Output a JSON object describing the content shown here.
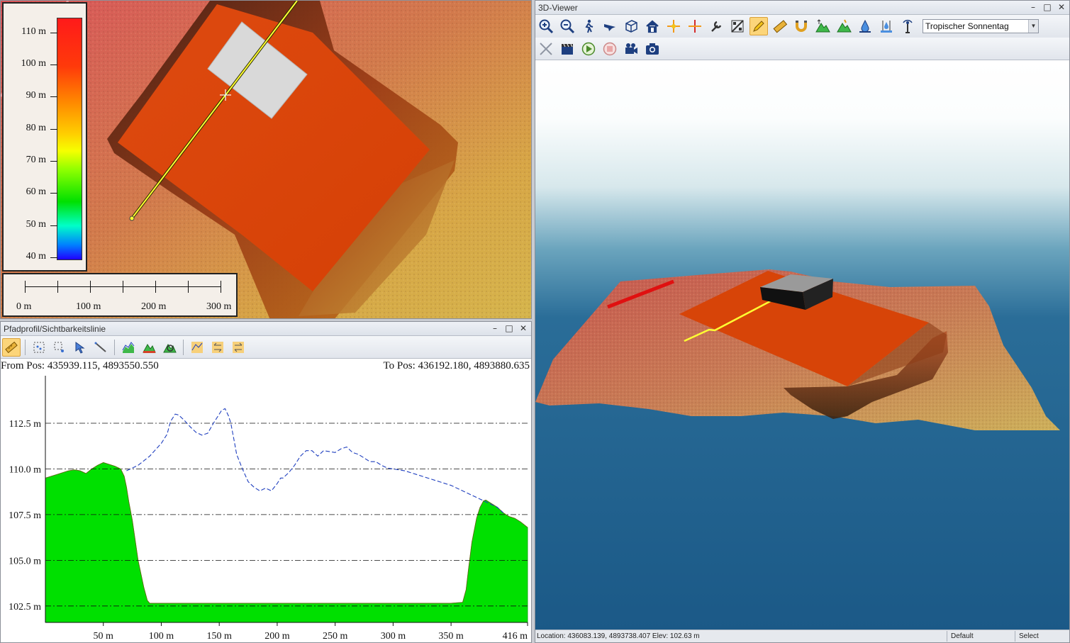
{
  "map": {
    "legend": {
      "ticks": [
        "110 m",
        "100 m",
        "90 m",
        "80 m",
        "70 m",
        "60 m",
        "50 m",
        "40 m"
      ]
    },
    "scalebar": {
      "labels": [
        "0 m",
        "100 m",
        "200 m",
        "300 m"
      ]
    }
  },
  "profile": {
    "title": "Pfadprofil/Sichtbarkeitslinie",
    "from_label": "From Pos: 435939.115, 4893550.550",
    "to_label": "To Pos: 436192.180, 4893880.635",
    "toolbar_icons": [
      "measure-path-icon",
      "select-points-icon",
      "select-area-icon",
      "pointer-icon",
      "line-tool-icon",
      "profile-chart-icon",
      "terrain-icon",
      "terrain-zoom-icon",
      "line-of-sight-icon",
      "reverse-icon",
      "swap-icon"
    ],
    "colors": {
      "terrain_fill": "#00e000",
      "sight_line": "#1f3fbf",
      "grid": "#111111"
    }
  },
  "chart_data": {
    "type": "area",
    "title": "",
    "xlabel": "",
    "ylabel": "",
    "xlim": [
      0,
      416
    ],
    "ylim": [
      101.6,
      115.1
    ],
    "x_ticks": [
      "50 m",
      "100 m",
      "150 m",
      "200 m",
      "250 m",
      "300 m",
      "350 m",
      "416 m"
    ],
    "x_tick_values": [
      50,
      100,
      150,
      200,
      250,
      300,
      350,
      416
    ],
    "y_ticks": [
      "112.5 m",
      "110.0 m",
      "107.5 m",
      "105.0 m",
      "102.5 m"
    ],
    "y_tick_values": [
      112.5,
      110.0,
      107.5,
      105.0,
      102.5
    ],
    "grid": "horizontal dash-dot",
    "series": [
      {
        "kind": "terrain-area",
        "x": [
          0,
          10,
          20,
          25,
          30,
          35,
          40,
          45,
          50,
          55,
          60,
          65,
          68,
          70,
          72,
          75,
          80,
          85,
          88,
          90,
          100,
          200,
          300,
          350,
          360,
          363,
          365,
          368,
          372,
          375,
          378,
          380,
          385,
          390,
          395,
          400,
          405,
          410,
          416
        ],
        "y": [
          109.5,
          109.7,
          109.9,
          109.95,
          109.9,
          109.75,
          110.0,
          110.2,
          110.35,
          110.25,
          110.15,
          110.0,
          109.6,
          109.0,
          108.2,
          107.2,
          105.0,
          103.5,
          102.8,
          102.65,
          102.65,
          102.65,
          102.65,
          102.65,
          102.7,
          103.4,
          104.5,
          106.0,
          107.3,
          107.9,
          108.25,
          108.3,
          108.1,
          107.9,
          107.6,
          107.4,
          107.3,
          107.1,
          106.8
        ]
      },
      {
        "kind": "line-of-sight",
        "x": [
          70,
          80,
          90,
          100,
          105,
          108,
          112,
          115,
          120,
          125,
          130,
          135,
          140,
          145,
          150,
          152,
          155,
          158,
          160,
          163,
          165,
          170,
          175,
          180,
          185,
          190,
          195,
          200,
          203,
          205,
          210,
          215,
          220,
          225,
          230,
          235,
          240,
          245,
          250,
          255,
          260,
          265,
          270,
          275,
          280,
          285,
          290,
          295,
          300,
          305,
          310,
          315,
          320,
          330,
          340,
          350,
          360,
          370,
          380,
          390,
          395
        ],
        "y": [
          109.9,
          110.2,
          110.7,
          111.4,
          111.9,
          112.6,
          113.0,
          112.95,
          112.65,
          112.3,
          112.0,
          111.85,
          111.95,
          112.5,
          113.0,
          113.2,
          113.3,
          112.9,
          112.5,
          111.5,
          110.8,
          110.0,
          109.3,
          109.0,
          108.8,
          108.95,
          108.8,
          109.2,
          109.5,
          109.5,
          109.8,
          110.2,
          110.7,
          111.0,
          111.0,
          110.7,
          111.0,
          110.95,
          110.9,
          111.1,
          111.2,
          110.9,
          110.8,
          110.6,
          110.4,
          110.4,
          110.2,
          110.05,
          110.0,
          109.95,
          109.9,
          109.8,
          109.7,
          109.5,
          109.3,
          109.1,
          108.8,
          108.5,
          108.2,
          107.9,
          107.6
        ]
      }
    ]
  },
  "viewer": {
    "title": "3D-Viewer",
    "toolbar_row1_icons": [
      "zoom-in-icon",
      "zoom-out-icon",
      "walk-icon",
      "fly-icon",
      "cube-view-icon",
      "home-icon",
      "target-icon",
      "crosshair-icon",
      "wrench-icon",
      "percent-icon",
      "pencil-icon",
      "ruler-icon",
      "magnet-icon",
      "terrain-raise-icon",
      "terrain-lower-icon",
      "water-drop-icon",
      "water-level-icon",
      "antenna-icon"
    ],
    "toolbar_row2_icons": [
      "airplane-icon",
      "clapperboard-icon",
      "play-icon",
      "stop-icon",
      "video-camera-icon",
      "photo-camera-icon"
    ],
    "weather_select": "Tropischer Sonnentag",
    "status": {
      "location": "Location: 436083.139, 4893738.407 Elev: 102.63 m",
      "mode": "Default",
      "tool": "Select"
    }
  }
}
